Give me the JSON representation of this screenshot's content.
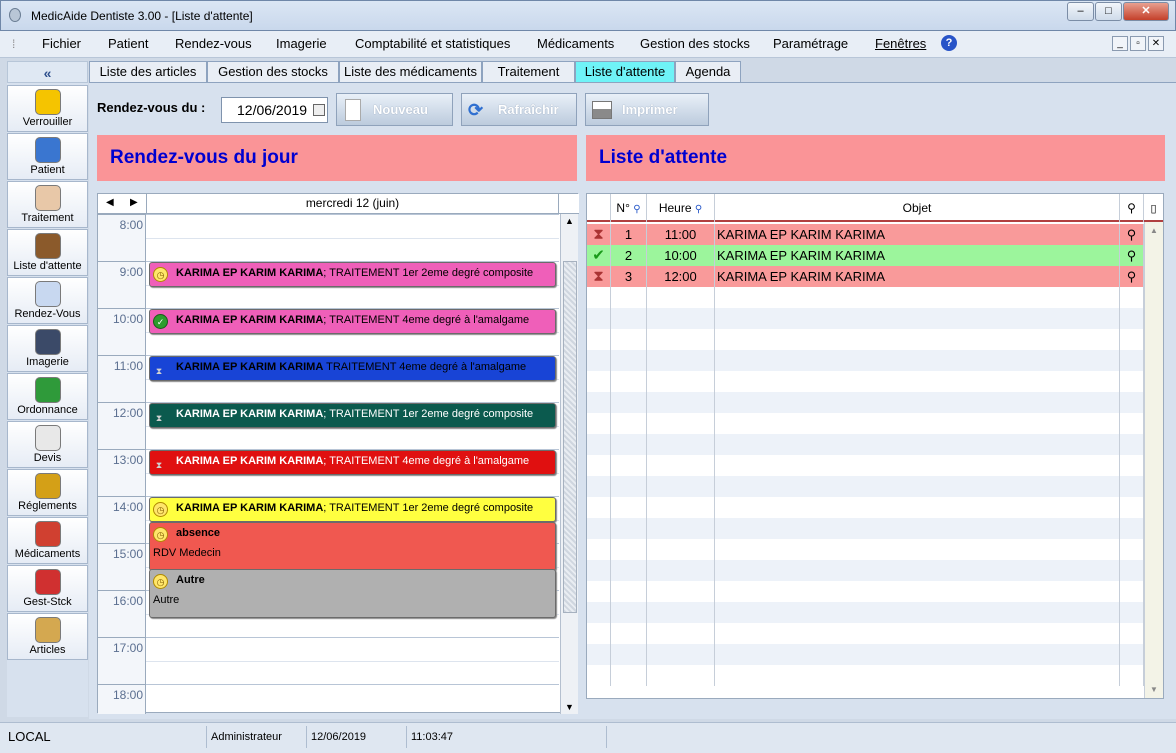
{
  "window": {
    "title": "MedicAide Dentiste 3.00  - [Liste d'attente]"
  },
  "menu": [
    "Fichier",
    "Patient",
    "Rendez-vous",
    "Imagerie",
    "Comptabilité et statistiques",
    "Médicaments",
    "Gestion des stocks",
    "Paramétrage",
    "Fenêtres"
  ],
  "sidebar": {
    "collapse_label": "«",
    "items": [
      {
        "label": "Verrouiller",
        "icon": "lock-icon"
      },
      {
        "label": "Patient",
        "icon": "patient-icon"
      },
      {
        "label": "Traitement",
        "icon": "doctor-icon"
      },
      {
        "label": "Liste d'attente",
        "icon": "hourglass-icon"
      },
      {
        "label": "Rendez-Vous",
        "icon": "calendar-clock-icon"
      },
      {
        "label": "Imagerie",
        "icon": "film-icon"
      },
      {
        "label": "Ordonnance",
        "icon": "caduceus-icon"
      },
      {
        "label": "Devis",
        "icon": "document-pen-icon"
      },
      {
        "label": "Réglements",
        "icon": "money-icon"
      },
      {
        "label": "Médicaments",
        "icon": "book-icon"
      },
      {
        "label": "Gest-Stck",
        "icon": "recycle-icon"
      },
      {
        "label": "Articles",
        "icon": "box-icon"
      }
    ]
  },
  "tabs": [
    {
      "label": "Liste des articles",
      "active": false
    },
    {
      "label": "Gestion des stocks",
      "active": false
    },
    {
      "label": "Liste des médicaments",
      "active": false
    },
    {
      "label": "Traitement",
      "active": false
    },
    {
      "label": "Liste d'attente",
      "active": true
    },
    {
      "label": "Agenda",
      "active": false
    }
  ],
  "toolbar": {
    "date_label": "Rendez-vous du :",
    "date_value": "12/06/2019",
    "new_label": "Nouveau",
    "refresh_label": "Rafraîchir",
    "print_label": "Imprimer"
  },
  "agenda": {
    "title": "Rendez-vous du jour",
    "day_header": "mercredi 12 (juin)",
    "hours": [
      "8:00",
      "9:00",
      "10:00",
      "11:00",
      "12:00",
      "13:00",
      "14:00",
      "15:00",
      "16:00",
      "17:00",
      "18:00"
    ],
    "appointments": [
      {
        "name": "KARIMA EP KARIM  KARIMA",
        "detail": "; TRAITEMENT 1er 2eme degré  composite",
        "color": "#ef5fb9",
        "text_color": "#000000",
        "status": "clock-icon"
      },
      {
        "name": "KARIMA EP KARIM  KARIMA",
        "detail": "; TRAITEMENT 4eme degré à l'amalgame",
        "color": "#ef5fb9",
        "text_color": "#000000",
        "status": "check-icon"
      },
      {
        "name": "KARIMA EP KARIM  KARIMA",
        "detail": " TRAITEMENT 4eme degré à l'amalgame",
        "color": "#1844d6",
        "text_color": "#000000",
        "status": "hourglass-icon"
      },
      {
        "name": "KARIMA EP KARIM  KARIMA",
        "detail": "; TRAITEMENT 1er 2eme degré  composite",
        "color": "#0b5a4e",
        "text_color": "#ffffff",
        "status": "hourglass-icon"
      },
      {
        "name": "KARIMA EP KARIM  KARIMA",
        "detail": "; TRAITEMENT 4eme degré à l'amalgame",
        "color": "#e01010",
        "text_color": "#ffffff",
        "status": "hourglass-icon"
      },
      {
        "name": "KARIMA EP KARIM  KARIMA",
        "detail": "; TRAITEMENT 1er 2eme degré  composite",
        "color": "#ffff40",
        "text_color": "#000000",
        "status": "clock-icon"
      }
    ],
    "blocks": [
      {
        "title": "absence",
        "sub": "RDV Medecin",
        "color": "#f05850"
      },
      {
        "title": "Autre",
        "sub": "Autre",
        "color": "#b0b0b0"
      }
    ]
  },
  "queue": {
    "title": "Liste d'attente",
    "columns": [
      "N°",
      "Heure",
      "Objet"
    ],
    "rows": [
      {
        "num": "1",
        "time": "11:00",
        "object": "KARIMA EP KARIM  KARIMA",
        "color": "#f99a9a",
        "status": "hourglass-icon"
      },
      {
        "num": "2",
        "time": "10:00",
        "object": "KARIMA EP KARIM  KARIMA",
        "color": "#9cf59c",
        "status": "check-icon"
      },
      {
        "num": "3",
        "time": "12:00",
        "object": "KARIMA EP KARIM  KARIMA",
        "color": "#f99a9a",
        "status": "hourglass-icon"
      }
    ]
  },
  "status": {
    "location": "LOCAL",
    "user": "Administrateur",
    "date": "12/06/2019",
    "time": "11:03:47"
  }
}
